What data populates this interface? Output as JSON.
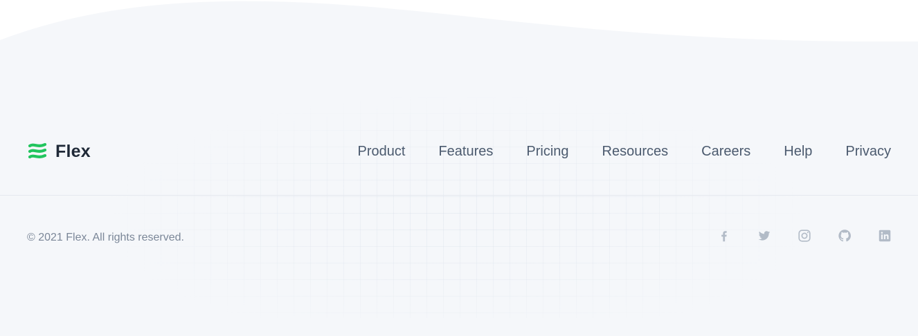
{
  "brand": {
    "name": "Flex",
    "accent_color": "#22c55e",
    "logo_icon": "flex-wave-logo-icon"
  },
  "nav": {
    "items": [
      {
        "label": "Product"
      },
      {
        "label": "Features"
      },
      {
        "label": "Pricing"
      },
      {
        "label": "Resources"
      },
      {
        "label": "Careers"
      },
      {
        "label": "Help"
      },
      {
        "label": "Privacy"
      }
    ]
  },
  "footer": {
    "copyright": "© 2021 Flex. All rights reserved.",
    "socials": [
      {
        "icon": "facebook-icon"
      },
      {
        "icon": "twitter-icon"
      },
      {
        "icon": "instagram-icon"
      },
      {
        "icon": "github-icon"
      },
      {
        "icon": "linkedin-icon"
      }
    ]
  },
  "colors": {
    "footer_background": "#f5f7fa",
    "nav_text": "#4b5a6e",
    "muted_text": "#7b8798",
    "icon_gray": "#b2bbc7"
  }
}
